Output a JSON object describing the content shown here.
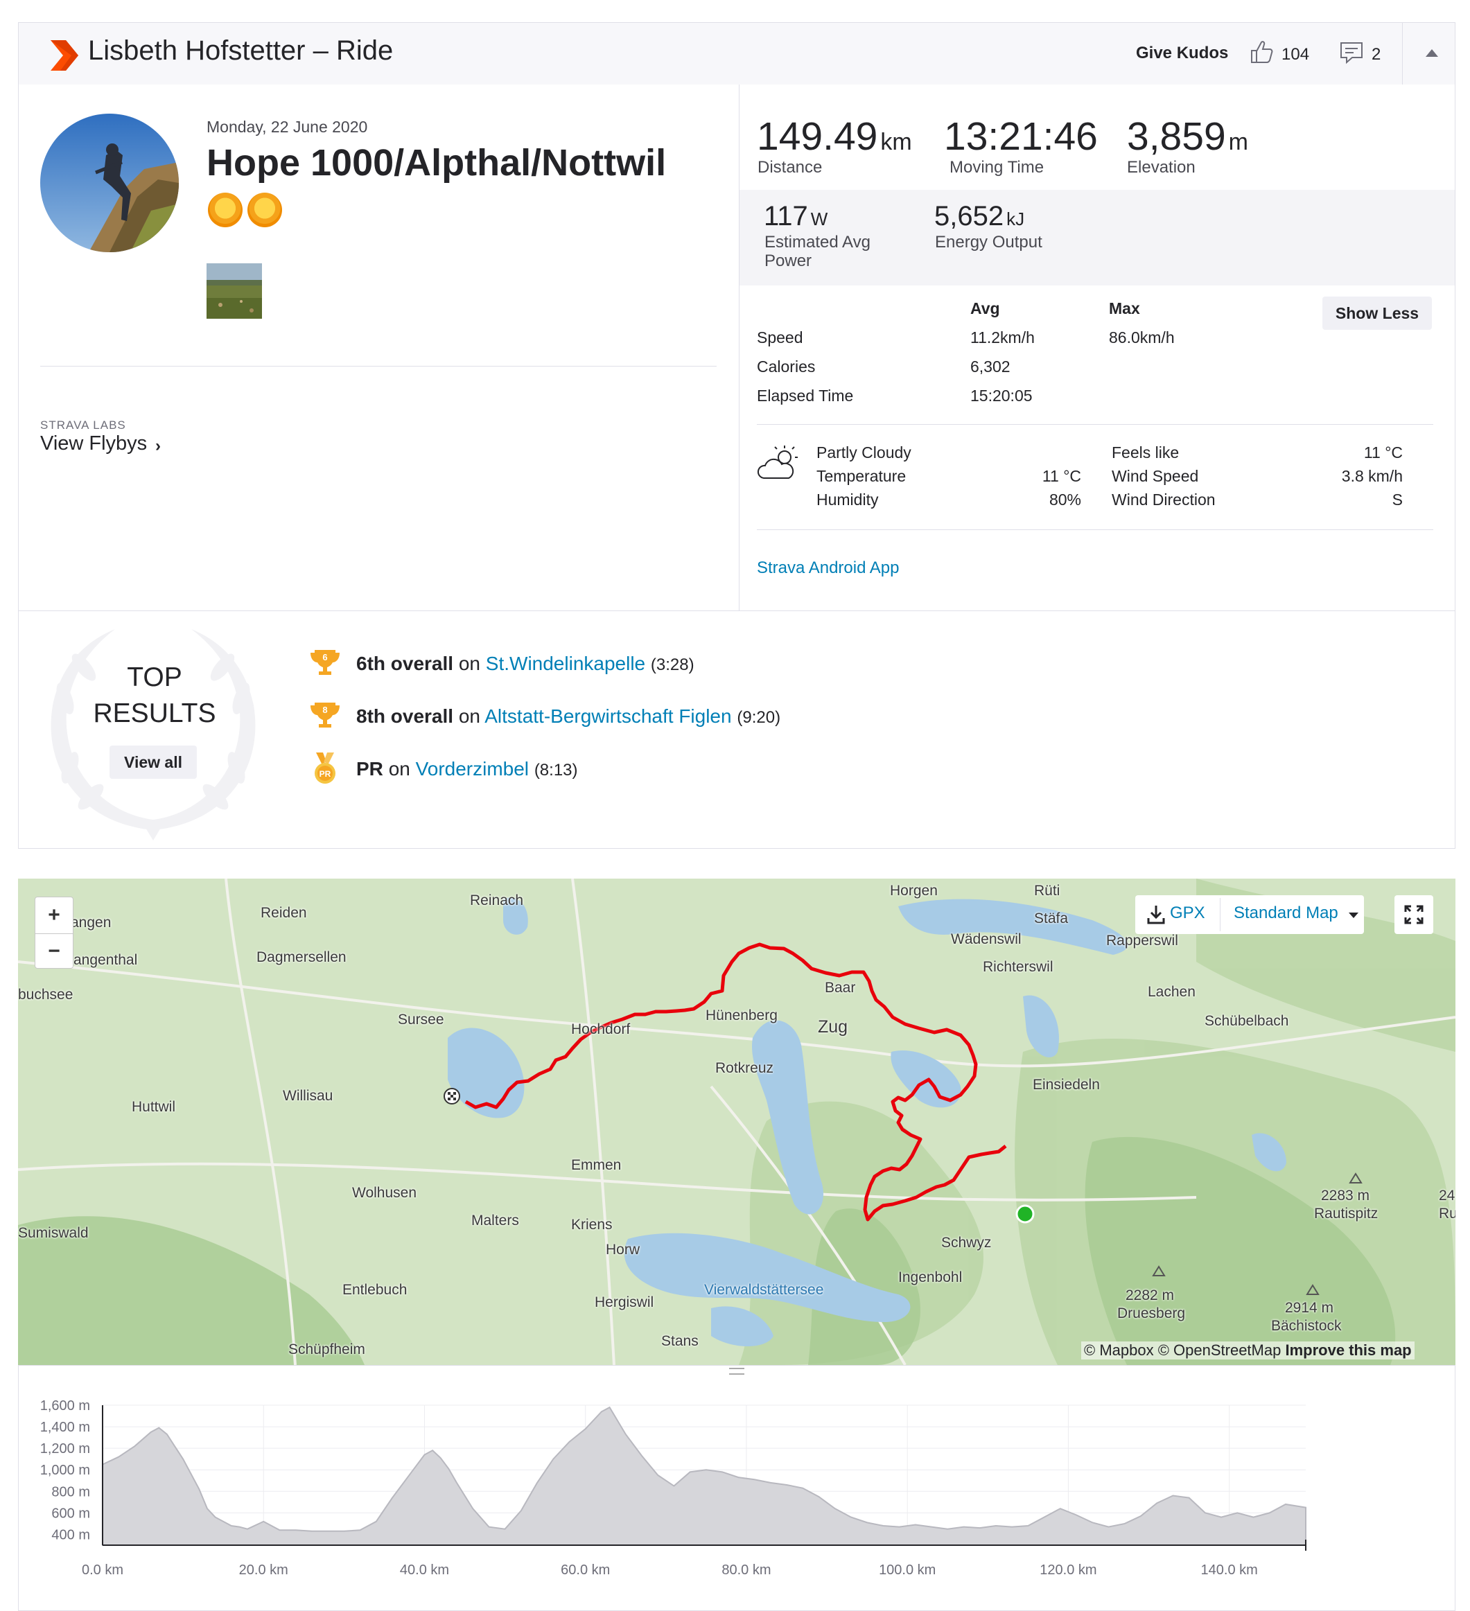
{
  "header": {
    "title": "Lisbeth Hofstetter – Ride",
    "give_kudos": "Give Kudos",
    "kudos_count": "104",
    "comment_count": "2",
    "brand_color": "#fc4c02"
  },
  "activity": {
    "date": "Monday, 22 June 2020",
    "name": "Hope 1000/Alpthal/Nottwil",
    "emoji": [
      "sun-with-face",
      "sun-with-face"
    ]
  },
  "labs": {
    "label": "STRAVA LABS",
    "view_flybys": "View Flybys"
  },
  "stats": {
    "distance": {
      "value": "149.49",
      "unit": "km",
      "label": "Distance"
    },
    "moving_time": {
      "value": "13:21:46",
      "label": "Moving Time"
    },
    "elevation": {
      "value": "3,859",
      "unit": "m",
      "label": "Elevation"
    },
    "power": {
      "value": "117",
      "unit": "W",
      "label": "Estimated Avg Power"
    },
    "energy": {
      "value": "5,652",
      "unit": "kJ",
      "label": "Energy Output"
    }
  },
  "more_stats": {
    "col_avg": "Avg",
    "col_max": "Max",
    "show_less": "Show Less",
    "rows": [
      {
        "label": "Speed",
        "avg": "11.2km/h",
        "max": "86.0km/h"
      },
      {
        "label": "Calories",
        "avg": "6,302",
        "max": ""
      },
      {
        "label": "Elapsed Time",
        "avg": "15:20:05",
        "max": ""
      }
    ]
  },
  "weather": {
    "condition": "Partly Cloudy",
    "temperature_label": "Temperature",
    "temperature": "11 °C",
    "humidity_label": "Humidity",
    "humidity": "80%",
    "feels_like_label": "Feels like",
    "feels_like": "11 °C",
    "wind_speed_label": "Wind Speed",
    "wind_speed": "3.8 km/h",
    "wind_direction_label": "Wind Direction",
    "wind_direction": "S",
    "icon": "partly-cloudy-icon"
  },
  "device": "Strava Android App",
  "top_results": {
    "title_line1": "TOP",
    "title_line2": "RESULTS",
    "view_all": "View all",
    "items": [
      {
        "badge": "6",
        "rank": "6th overall",
        "on": "on",
        "segment": "St.Windelinkapelle",
        "time": "(3:28)",
        "kind": "trophy"
      },
      {
        "badge": "8",
        "rank": "8th overall",
        "on": "on",
        "segment": "Altstatt-Bergwirtschaft Figlen",
        "time": "(9:20)",
        "kind": "trophy"
      },
      {
        "badge": "PR",
        "rank": "PR",
        "on": "on",
        "segment": "Vorderzimbel",
        "time": "(8:13)",
        "kind": "medal"
      }
    ]
  },
  "map": {
    "zoom_in": "+",
    "zoom_out": "−",
    "gpx": "GPX",
    "map_type": "Standard Map",
    "attribution_1": "© Mapbox © OpenStreetMap",
    "attribution_2": "Improve this map",
    "route_color": "#e8000b",
    "labels": {
      "langen": "angen",
      "reiden": "Reiden",
      "reinach": "Reinach",
      "horgen": "Horgen",
      "staefa": "Stäfa",
      "waedenswil": "Wädenswil",
      "rapperswil": "Rapperswil",
      "richterswil": "Richterswil",
      "langenthal": "angenthal",
      "dagmersellen": "Dagmersellen",
      "buchsee": "buchsee",
      "baar": "Baar",
      "lachen": "Lachen",
      "sursee": "Sursee",
      "hochdorf": "Hochdorf",
      "huenenberg": "Hünenberg",
      "zug": "Zug",
      "schuebelbach": "Schübelbach",
      "rotkreuz": "Rotkreuz",
      "einsiedeln": "Einsiedeln",
      "huttwil": "Huttwil",
      "willisau": "Willisau",
      "emmen": "Emmen",
      "wolhusen": "Wolhusen",
      "malters": "Malters",
      "kriens": "Kriens",
      "sumiswald": "Sumiswald",
      "horw": "Horw",
      "schwyz": "Schwyz",
      "rautispitz_h": "2283 m",
      "rautispitz": "Rautispitz",
      "entlebuch": "Entlebuch",
      "vierwaldstaettersee": "Vierwaldstättersee",
      "ingenbohl": "Ingenbohl",
      "druesberg_h": "2282 m",
      "druesberg": "Druesberg",
      "hergiswil": "Hergiswil",
      "baechistock_h": "2914 m",
      "baechistock": "Bächistock",
      "schuepfheim": "Schüpfheim",
      "stans": "Stans",
      "edge_24": "24",
      "edge_ru": "Ru",
      "rueti": "Rüti"
    }
  },
  "elevation_chart": {
    "type": "area",
    "y_ticks": [
      "1,600 m",
      "1,400 m",
      "1,200 m",
      "1,000 m",
      "800 m",
      "600 m",
      "400 m"
    ],
    "x_ticks": [
      "0.0 km",
      "20.0 km",
      "40.0 km",
      "60.0 km",
      "80.0 km",
      "100.0 km",
      "120.0 km",
      "140.0 km"
    ],
    "ylim": [
      300,
      1600
    ],
    "xlim": [
      0,
      149.5
    ],
    "x": [
      0,
      2,
      4,
      6,
      7,
      8,
      10,
      12,
      13,
      14,
      16,
      17,
      18,
      20,
      22,
      24,
      26,
      28,
      30,
      32,
      34,
      36,
      38,
      40,
      41,
      42,
      43,
      44,
      46,
      48,
      50,
      52,
      54,
      56,
      58,
      60,
      62,
      63,
      65,
      67,
      69,
      71,
      73,
      75,
      77,
      79,
      81,
      83,
      85,
      87,
      89,
      91,
      93,
      95,
      97,
      99,
      101,
      103,
      105,
      107,
      109,
      111,
      113,
      115,
      117,
      119,
      121,
      123,
      125,
      127,
      129,
      131,
      133,
      135,
      137,
      139,
      141,
      143,
      145,
      147,
      149.5
    ],
    "values": [
      1050,
      1120,
      1220,
      1350,
      1390,
      1330,
      1100,
      820,
      640,
      560,
      480,
      470,
      450,
      520,
      440,
      440,
      430,
      430,
      430,
      440,
      520,
      740,
      940,
      1140,
      1180,
      1110,
      1010,
      880,
      640,
      470,
      450,
      620,
      880,
      1100,
      1260,
      1380,
      1540,
      1580,
      1330,
      1130,
      950,
      850,
      980,
      1000,
      980,
      930,
      910,
      880,
      860,
      830,
      750,
      640,
      560,
      510,
      480,
      470,
      490,
      470,
      450,
      470,
      460,
      480,
      470,
      480,
      560,
      640,
      580,
      510,
      470,
      500,
      570,
      690,
      760,
      740,
      600,
      560,
      600,
      560,
      600,
      680,
      650
    ]
  }
}
